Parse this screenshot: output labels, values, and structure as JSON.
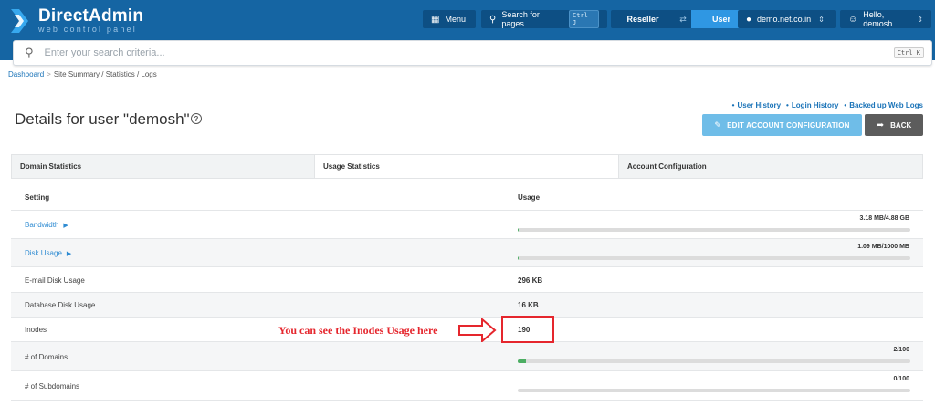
{
  "app": {
    "brand": "DirectAdmin",
    "brand_sub": "web control panel"
  },
  "topnav": {
    "menu_label": "Menu",
    "search_pages_label": "Search for pages",
    "search_pages_shortcut": "Ctrl J",
    "role_reseller": "Reseller",
    "role_user": "User",
    "domain_label": "demo.net.co.in",
    "greeting_label": "Hello, demosh"
  },
  "search": {
    "placeholder": "Enter your search criteria...",
    "shortcut": "Ctrl K"
  },
  "breadcrumb": {
    "root": "Dashboard",
    "separator": ">",
    "path": "Site Summary / Statistics / Logs"
  },
  "header": {
    "title": "Details for user \"demosh\"",
    "help": "?",
    "links": [
      "User History",
      "Login History",
      "Backed up Web Logs"
    ],
    "edit_button": "EDIT ACCOUNT CONFIGURATION",
    "back_button": "BACK"
  },
  "tabs": [
    {
      "label": "Domain Statistics"
    },
    {
      "label": "Usage Statistics"
    },
    {
      "label": "Account Configuration"
    }
  ],
  "table": {
    "col_setting": "Setting",
    "col_usage": "Usage",
    "rows": [
      {
        "setting": "Bandwidth",
        "label": "3.18 MB/4.88 GB",
        "fill": 0.001
      },
      {
        "setting": "Disk Usage",
        "label": "1.09 MB/1000 MB",
        "fill": 0.001
      },
      {
        "setting": "E-mail Disk Usage",
        "value": "296 KB"
      },
      {
        "setting": "Database Disk Usage",
        "value": "16 KB"
      },
      {
        "setting": "Inodes",
        "value": "190"
      },
      {
        "setting": "# of Domains",
        "label": "2/100",
        "fill": 0.02
      },
      {
        "setting": "# of Subdomains",
        "label": "0/100",
        "fill": 0
      }
    ]
  },
  "annotation": {
    "text": "You can see the Inodes Usage here"
  },
  "colors": {
    "topbar": "#1565a3",
    "accent": "#2f97e3",
    "annotation": "#e5262d",
    "progress": "#4cae63"
  }
}
